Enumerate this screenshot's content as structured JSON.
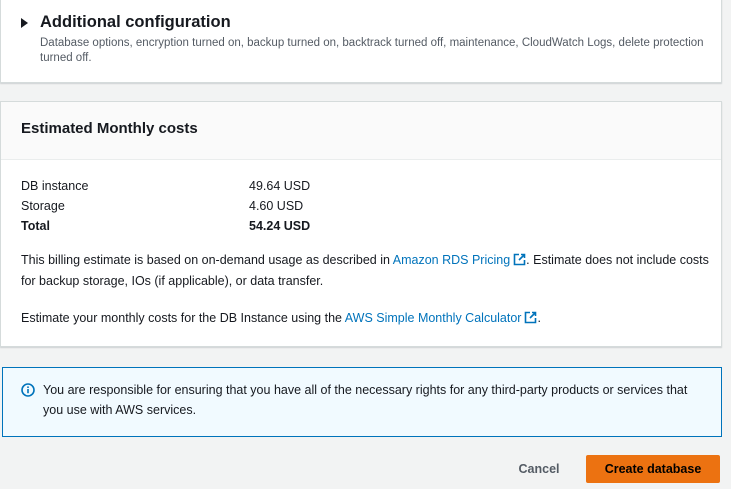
{
  "additional_configuration": {
    "title": "Additional configuration",
    "description": "Database options, encryption turned on, backup turned on, backtrack turned off, maintenance, CloudWatch Logs, delete protection turned off."
  },
  "estimated_costs": {
    "title": "Estimated Monthly costs",
    "rows": [
      {
        "label": "DB instance",
        "value": "49.64 USD"
      },
      {
        "label": "Storage",
        "value": "4.60 USD"
      },
      {
        "label": "Total",
        "value": "54.24 USD"
      }
    ],
    "note_prefix": "This billing estimate is based on on-demand usage as described in ",
    "pricing_link": "Amazon RDS Pricing",
    "note_suffix": ". Estimate does not include costs for backup storage, IOs (if applicable), or data transfer.",
    "calc_prefix": "Estimate your monthly costs for the DB Instance using the ",
    "calc_link": "AWS Simple Monthly Calculator",
    "calc_suffix": "."
  },
  "info_alert": {
    "text": "You are responsible for ensuring that you have all of the necessary rights for any third-party products or services that you use with AWS services."
  },
  "footer": {
    "cancel_label": "Cancel",
    "create_label": "Create database"
  },
  "colors": {
    "primary_button": "#ec7211",
    "link": "#0073bb",
    "info_border": "#0073bb",
    "info_bg": "#f1faff"
  }
}
